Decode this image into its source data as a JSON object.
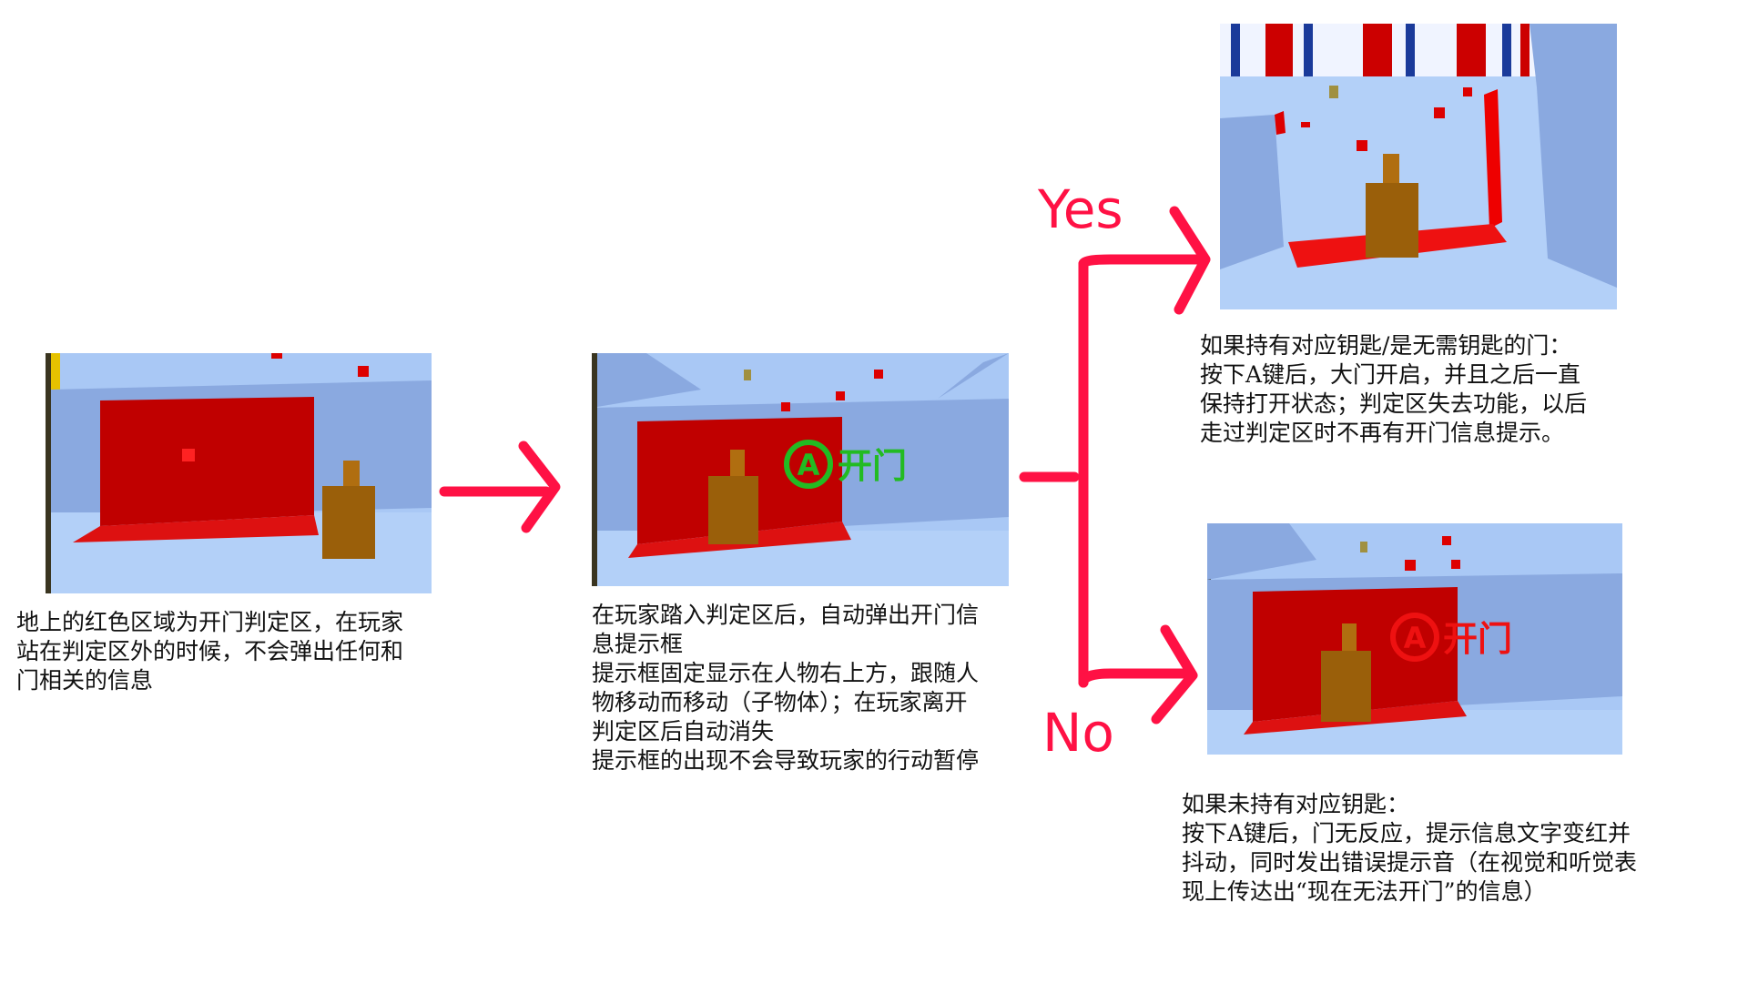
{
  "colors": {
    "arrow": "#ff1144",
    "prompt_ok": "#22bb22",
    "prompt_error": "#ee1111",
    "door_zone": "#cc0000",
    "floor": "#a9c8f5",
    "wall": "#8aa9e0",
    "character": "#a0620c"
  },
  "panels": {
    "outside": {
      "caption": "地上的红色区域为开门判定区，在玩家\n站在判定区外的时候，不会弹出任何和\n门相关的信息"
    },
    "inside": {
      "prompt_button": "A",
      "prompt_text": "开门",
      "caption": "在玩家踏入判定区后，自动弹出开门信\n息提示框\n提示框固定显示在人物右上方，跟随人\n物移动而移动（子物体）；在玩家离开\n判定区后自动消失\n提示框的出现不会导致玩家的行动暂停"
    },
    "yes": {
      "caption": "如果持有对应钥匙/是无需钥匙的门：\n按下A键后，大门开启，并且之后一直\n保持打开状态；判定区失去功能，以后\n走过判定区时不再有开门信息提示。"
    },
    "no": {
      "prompt_button": "A",
      "prompt_text": "开门",
      "caption": "如果未持有对应钥匙：\n按下A键后，门无反应，提示信息文字变红并\n抖动，同时发出错误提示音（在视觉和听觉表\n现上传达出“现在无法开门”的信息）"
    }
  },
  "branches": {
    "yes_label": "Yes",
    "no_label": "No"
  }
}
